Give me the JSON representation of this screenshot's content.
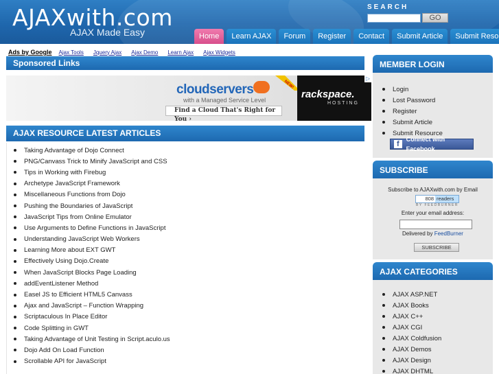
{
  "header": {
    "logo": "AJAXwith.com",
    "tagline": "AJAX Made Easy",
    "search_label": "SEARCH",
    "search_button": "GO",
    "nav": [
      "Home",
      "Learn AJAX",
      "Forum",
      "Register",
      "Contact",
      "Submit Article",
      "Submit Resource"
    ]
  },
  "ads_row": {
    "ads_by": "Ads by Google",
    "links": [
      "Ajax Tools",
      "Jquery Ajax",
      "Ajax Demo",
      "Learn Ajax",
      "Ajax Widgets"
    ]
  },
  "sponsored": {
    "title": "Sponsored Links",
    "banner": {
      "headline": "cloudservers",
      "sub": "with a Managed Service Level",
      "cta": "Find a Cloud That's Right for You  ›",
      "new_tag": "NEW!",
      "brand": "rackspace.",
      "brand_sub": "HOSTING",
      "ad_choice": "▷"
    }
  },
  "articles": {
    "title": "AJAX RESOURCE LATEST ARTICLES",
    "items": [
      "Taking Advantage of Dojo Connect",
      "PNG/Canvass Trick to Minify JavaScript and CSS",
      "Tips in Working with Firebug",
      "Archetype JavaScript Framework",
      "Miscellaneous Functions from Dojo",
      "Pushing the Boundaries of JavaScript",
      "JavaScript Tips from Online Emulator",
      "Use Arguments to Define Functions in JavaScript",
      "Understanding JavaScript Web Workers",
      "Learning More about EXT GWT",
      "Effectively Using Dojo.Create",
      "When JavaScript Blocks Page Loading",
      "addEventListener Method",
      "Easel JS to Efficient HTML5 Canvass",
      "Ajax and JavaScript – Function Wrapping",
      "Scriptaculous In Place Editor",
      "Code Splitting in GWT",
      "Taking Advantage of Unit Testing in Script.aculo.us",
      "Dojo Add On Load Function",
      "Scrollable API for JavaScript"
    ]
  },
  "member": {
    "title": "MEMBER LOGIN",
    "items": [
      "Login",
      "Lost Password",
      "Register",
      "Submit Article",
      "Submit Resource"
    ],
    "facebook": "Connect with Facebook"
  },
  "subscribe": {
    "title": "SUBSCRIBE",
    "line1": "Subscribe to AJAXwith.com by Email",
    "readers_count": "808",
    "readers_label": "readers",
    "feedburner_tag": "BY FEEDBURNER",
    "email_label": "Enter your email address:",
    "delivered_by": "Delivered by",
    "feedburner": "FeedBurner",
    "button": "SUBSCRIBE"
  },
  "categories": {
    "title": "AJAX CATEGORIES",
    "items": [
      "AJAX ASP.NET",
      "AJAX Books",
      "AJAX C++",
      "AJAX CGI",
      "AJAX Coldfusion",
      "AJAX Demos",
      "AJAX Design",
      "AJAX DHTML"
    ]
  }
}
